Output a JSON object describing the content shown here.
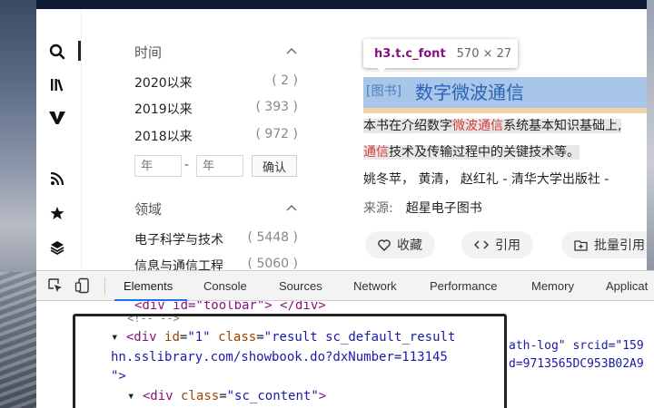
{
  "filters": {
    "time": {
      "title": "时间",
      "items": [
        {
          "label": "2020以来",
          "count": "( 2 )"
        },
        {
          "label": "2019以来",
          "count": "( 393 )"
        },
        {
          "label": "2018以来",
          "count": "( 972 )"
        }
      ],
      "year_from_placeholder": "年",
      "year_to_placeholder": "年",
      "dash": "-",
      "confirm_label": "确认"
    },
    "field": {
      "title": "领域",
      "items": [
        {
          "label": "电子科学与技术",
          "count": "( 5448 )"
        },
        {
          "label": "信息与通信工程",
          "count": "( 5060 )"
        }
      ]
    }
  },
  "tooltip": {
    "selector": "h3.t.c_font",
    "size": "570 × 27"
  },
  "result": {
    "tag": "[图书]",
    "title": "数字微波通信",
    "snippet": {
      "p1": "本书在介绍数字",
      "p2": "微波通信",
      "p3": "系统基本知识基础上,",
      "p4": "通信",
      "p5": "技术及传输过程中的关键技术等。"
    },
    "authors": "姚冬苹， 黄清， 赵红礼 - 清华大学出版社 -",
    "source_label": "来源:",
    "source_value": "超星电子图书",
    "actions": {
      "collect": "收藏",
      "cite": "引用",
      "batch_cite": "批量引用"
    }
  },
  "devtools": {
    "tabs": [
      "Elements",
      "Console",
      "Sources",
      "Network",
      "Performance",
      "Memory",
      "Applicat"
    ],
    "code": {
      "l0_a": "<div id=\"toolbar\"> </div>",
      "l0b": "<!-- -->",
      "l1_open": "<div ",
      "l1_id_attr": "id",
      "l1_id_val": "\"1\"",
      "l1_class_attr": "class",
      "l1_class_val": "\"result sc_default_result",
      "l1_tail": "ath-log\" srcid=\"159",
      "l2": "hn.sslibrary.com/showbook.do?dxNumber=113145",
      "l2_tail": "d=9713565DC953B02A9",
      "l3": "\">",
      "l4_open": "<div ",
      "l4_attr": "class",
      "l4_val": "\"sc_content\"",
      "l4_close": ">"
    }
  },
  "colors": {
    "accent": "#1a73e8",
    "title_blue": "#2b62b8",
    "highlight_red": "#d23a3a",
    "selection": "#a8c6e8"
  }
}
